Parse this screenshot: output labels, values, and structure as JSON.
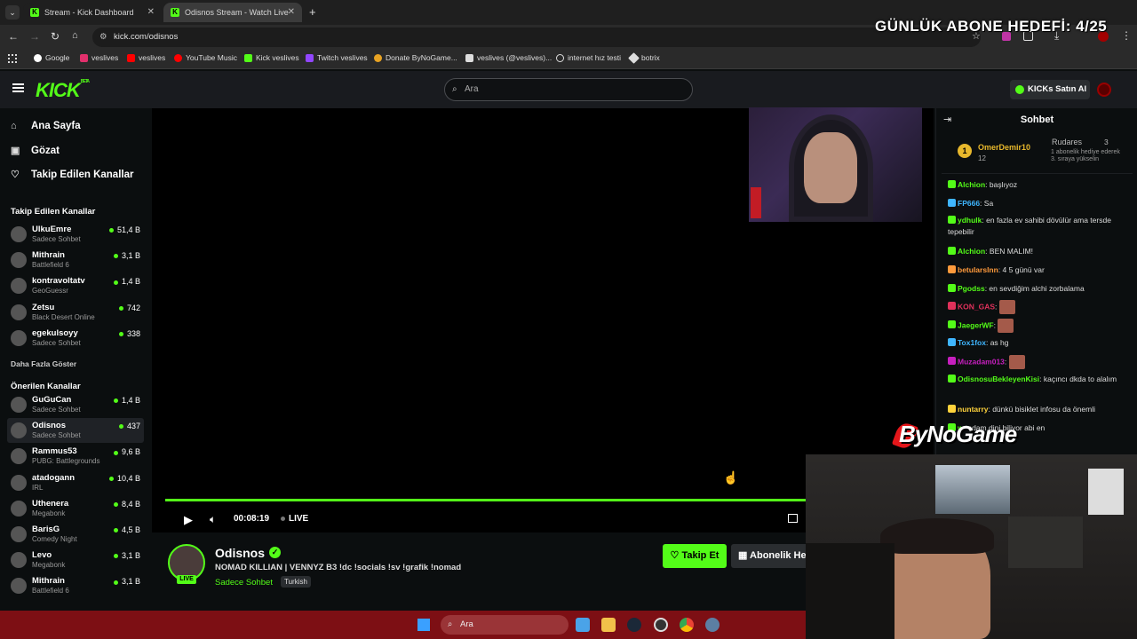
{
  "browser": {
    "tabs": [
      {
        "title": "Stream - Kick Dashboard",
        "active": false
      },
      {
        "title": "Odisnos Stream - Watch Live o",
        "active": true
      }
    ],
    "url": "kick.com/odisnos",
    "bookmarks": [
      "Google",
      "veslives",
      "veslives",
      "YouTube Music",
      "Kick veslives",
      "Twitch veslives",
      "Donate ByNoGame...",
      "veslives (@veslives)...",
      "internet hız testi",
      "botrix"
    ]
  },
  "header": {
    "logo": "KICK",
    "logo_sup": "BETA",
    "search_placeholder": "Ara",
    "kicks_button": "KICKs Satın Al"
  },
  "sidebar": {
    "nav": [
      {
        "label": "Ana Sayfa",
        "icon": "home-icon"
      },
      {
        "label": "Gözat",
        "icon": "browse-icon"
      },
      {
        "label": "Takip Edilen Kanallar",
        "icon": "heart-icon"
      }
    ],
    "followed_title": "Takip Edilen Kanallar",
    "followed": [
      {
        "name": "UlkuEmre",
        "game": "Sadece Sohbet",
        "viewers": "51,4 B"
      },
      {
        "name": "Mithrain",
        "game": "Battlefield 6",
        "viewers": "3,1 B"
      },
      {
        "name": "kontravoltatv",
        "game": "GeoGuessr",
        "viewers": "1,4 B"
      },
      {
        "name": "Zetsu",
        "game": "Black Desert Online",
        "viewers": "742"
      },
      {
        "name": "egekulsoyy",
        "game": "Sadece Sohbet",
        "viewers": "338"
      }
    ],
    "show_more": "Daha Fazla Göster",
    "recommended_title": "Önerilen Kanallar",
    "recommended": [
      {
        "name": "GuGuCan",
        "game": "Sadece Sohbet",
        "viewers": "1,4 B"
      },
      {
        "name": "Odisnos",
        "game": "Sadece Sohbet",
        "viewers": "437",
        "active": true
      },
      {
        "name": "Rammus53",
        "game": "PUBG: Battlegrounds",
        "viewers": "9,6 B"
      },
      {
        "name": "atadogann",
        "game": "IRL",
        "viewers": "10,4 B"
      },
      {
        "name": "Uthenera",
        "game": "Megabonk",
        "viewers": "8,4 B"
      },
      {
        "name": "BarisG",
        "game": "Comedy Night",
        "viewers": "4,5 B"
      },
      {
        "name": "Levo",
        "game": "Megabonk",
        "viewers": "3,1 B"
      },
      {
        "name": "Mithrain",
        "game": "Battlefield 6",
        "viewers": "3,1 B"
      }
    ]
  },
  "player": {
    "time": "00:08:19",
    "live_label": "LIVE",
    "progress": 1.0
  },
  "stream": {
    "name": "Odisnos",
    "live_tag": "LIVE",
    "title": "NOMAD KILLIAN | VENNYZ B3 !dc !socials !sv !grafik !nomad",
    "category": "Sadece Sohbet",
    "tag": "Turkish",
    "follow_label": "Takip Et",
    "sub_label": "Abonelik He"
  },
  "chat": {
    "title": "Sohbet",
    "pinned": {
      "rank": "1",
      "user": "OmerDemir10",
      "user_count": "12",
      "user2": "Rudares",
      "user2_count": "3",
      "note": "1 abonelik hediye ederek 3. sıraya yükselin"
    },
    "messages": [
      {
        "user": "Alchion",
        "color": "#53fc18",
        "text": ": başlıyoz"
      },
      {
        "user": "FP666",
        "color": "#3fb6ff",
        "text": ": Sa"
      },
      {
        "user": "ydhulk",
        "color": "#53fc18",
        "text": ": en fazla ev sahibi dövülür ama tersde tepebilir"
      },
      {
        "user": "Alchion",
        "color": "#53fc18",
        "text": ": BEN MALIM!"
      },
      {
        "user": "betularslnn",
        "color": "#ff9a3c",
        "text": ": 4 5 günü var"
      },
      {
        "user": "Pgodss",
        "color": "#53fc18",
        "text": ": en sevdiğim alchi zorbalama"
      },
      {
        "user": "KON_GAS",
        "color": "#e0315b",
        "text": ":"
      },
      {
        "user": "JaegerWF",
        "color": "#53fc18",
        "text": ":"
      },
      {
        "user": "Tox1fox",
        "color": "#3fb6ff",
        "text": ": as hg"
      },
      {
        "user": "Muzadam013",
        "color": "#c71fbf",
        "text": ":"
      },
      {
        "user": "OdisnosuBekleyenKisi",
        "color": "#53fc18",
        "text": ": kaçıncı dkda to alalım"
      },
      {
        "user": "nuntarry",
        "color": "#ffd33c",
        "text": ": dünkü bisiklet infosu da önemli"
      },
      {
        "user": "w",
        "color": "#53fc18",
        "text": ": adam     dini biliyor abi en"
      }
    ]
  },
  "overlay": {
    "goal": "GÜNLÜK ABONE HEDEFİ: 4/25",
    "brand": "ByNoGame"
  },
  "taskbar": {
    "search_placeholder": "Ara"
  },
  "colors": {
    "accent": "#53fc18",
    "background": "#0b0e0f",
    "taskbar": "#7d0f14"
  }
}
